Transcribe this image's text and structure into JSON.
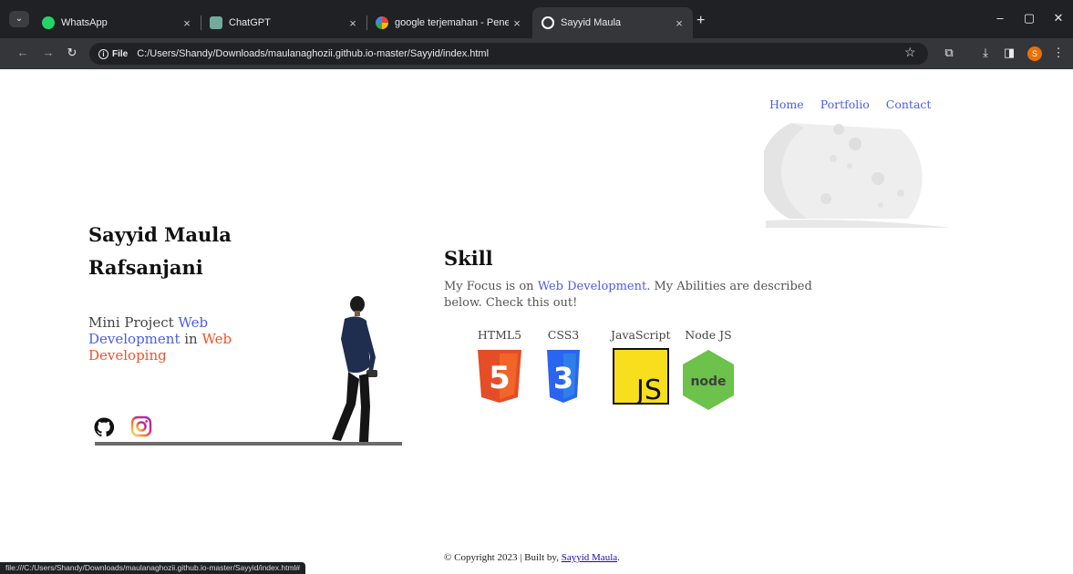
{
  "browser": {
    "tabs": [
      {
        "title": "WhatsApp",
        "active": false,
        "favicon_color": "#25d366"
      },
      {
        "title": "ChatGPT",
        "active": false,
        "favicon_color": "#74aa9c"
      },
      {
        "title": "google terjemahan - Penelusuri",
        "active": false,
        "favicon_color": "#4285f4"
      },
      {
        "title": "Sayyid Maula",
        "active": true,
        "favicon_color": "#ffffff"
      }
    ],
    "new_tab": "+",
    "close_glyph": "×",
    "address": {
      "chip_label": "File",
      "url": "C:/Users/Shandy/Downloads/maulanaghozii.github.io-master/Sayyid/index.html"
    },
    "profile_initial": "S",
    "status_url": "file:///C:/Users/Shandy/Downloads/maulanaghozii.github.io-master/Sayyid/index.html#"
  },
  "nav": {
    "home": "Home",
    "portfolio": "Portfolio",
    "contact": "Contact"
  },
  "hero": {
    "name": "Sayyid Maula Rafsanjani",
    "tagline_1": "Mini Project ",
    "tagline_2": "Web Development",
    "tagline_3": " in ",
    "tagline_4": "Web Developing"
  },
  "skill": {
    "title": "Skill",
    "desc_1": "My Focus is on ",
    "desc_2": "Web Development",
    "desc_3": ". My Abilities are described below. Check this out!",
    "items": [
      {
        "label": "HTML5",
        "glyph": "5"
      },
      {
        "label": "CSS3",
        "glyph": "3"
      },
      {
        "label": "JavaScript",
        "glyph": "JS"
      },
      {
        "label": "Node JS",
        "glyph": "node"
      }
    ]
  },
  "footer": {
    "prefix": "© Copyright 2023 | Built by, ",
    "author": "Sayyid Maula",
    "suffix": "."
  },
  "colors": {
    "accent_blue": "#4b5ce6",
    "accent_orange": "#f0522b",
    "html5": "#e44d26",
    "css3": "#2965f1",
    "js": "#f7df1e",
    "node": "#6cc24a"
  }
}
